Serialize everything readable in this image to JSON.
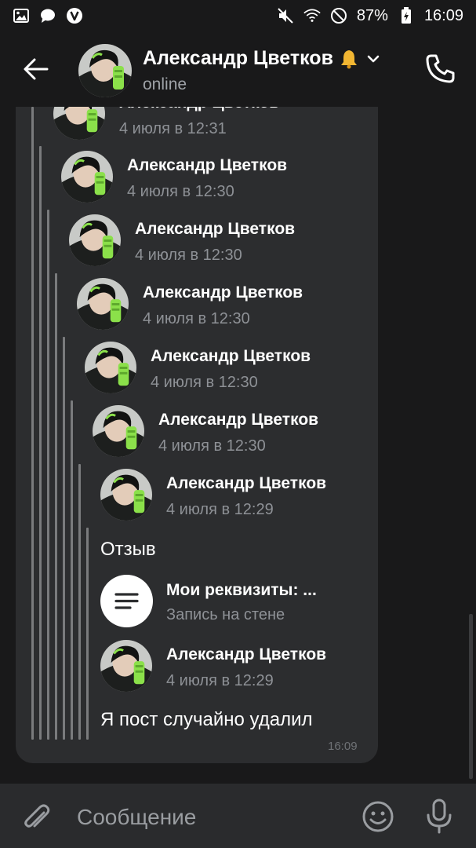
{
  "status_bar": {
    "battery": "87%",
    "time": "16:09",
    "left_icons": [
      "image-icon",
      "chat-bubble-icon",
      "viber-v-icon"
    ],
    "right_icons": [
      "mute-icon",
      "wifi-icon",
      "no-disturb-icon",
      "battery-icon"
    ]
  },
  "header": {
    "name": "Александр Цветков",
    "status": "online",
    "icons": [
      "back-arrow-icon",
      "bell-icon",
      "chevron-down-icon",
      "phone-icon"
    ]
  },
  "forwarded": [
    {
      "name": "Александр Цветков",
      "date": "4 июля в 12:31"
    },
    {
      "name": "Александр Цветков",
      "date": "4 июля в 12:30"
    },
    {
      "name": "Александр Цветков",
      "date": "4 июля в 12:30"
    },
    {
      "name": "Александр Цветков",
      "date": "4 июля в 12:30"
    },
    {
      "name": "Александр Цветков",
      "date": "4 июля в 12:30"
    },
    {
      "name": "Александр Цветков",
      "date": "4 июля в 12:30"
    },
    {
      "name": "Александр Цветков",
      "date": "4 июля в 12:29"
    },
    {
      "name": "Александр Цветков",
      "date": "4 июля в 12:29"
    }
  ],
  "messages": {
    "review": "Отзыв",
    "last": "Я пост случайно удалил",
    "time": "16:09"
  },
  "attachment": {
    "title": "Мои реквизиты: ...",
    "subtitle": "Запись на стене",
    "icon": "document-lines-icon"
  },
  "input": {
    "placeholder": "Сообщение",
    "icons": [
      "paperclip-icon",
      "smile-icon",
      "microphone-icon"
    ]
  },
  "colors": {
    "background": "#19191a",
    "bubble": "#2c2d2f",
    "secondary_text": "#8e9196",
    "avatar_accent": "#8be04a"
  }
}
